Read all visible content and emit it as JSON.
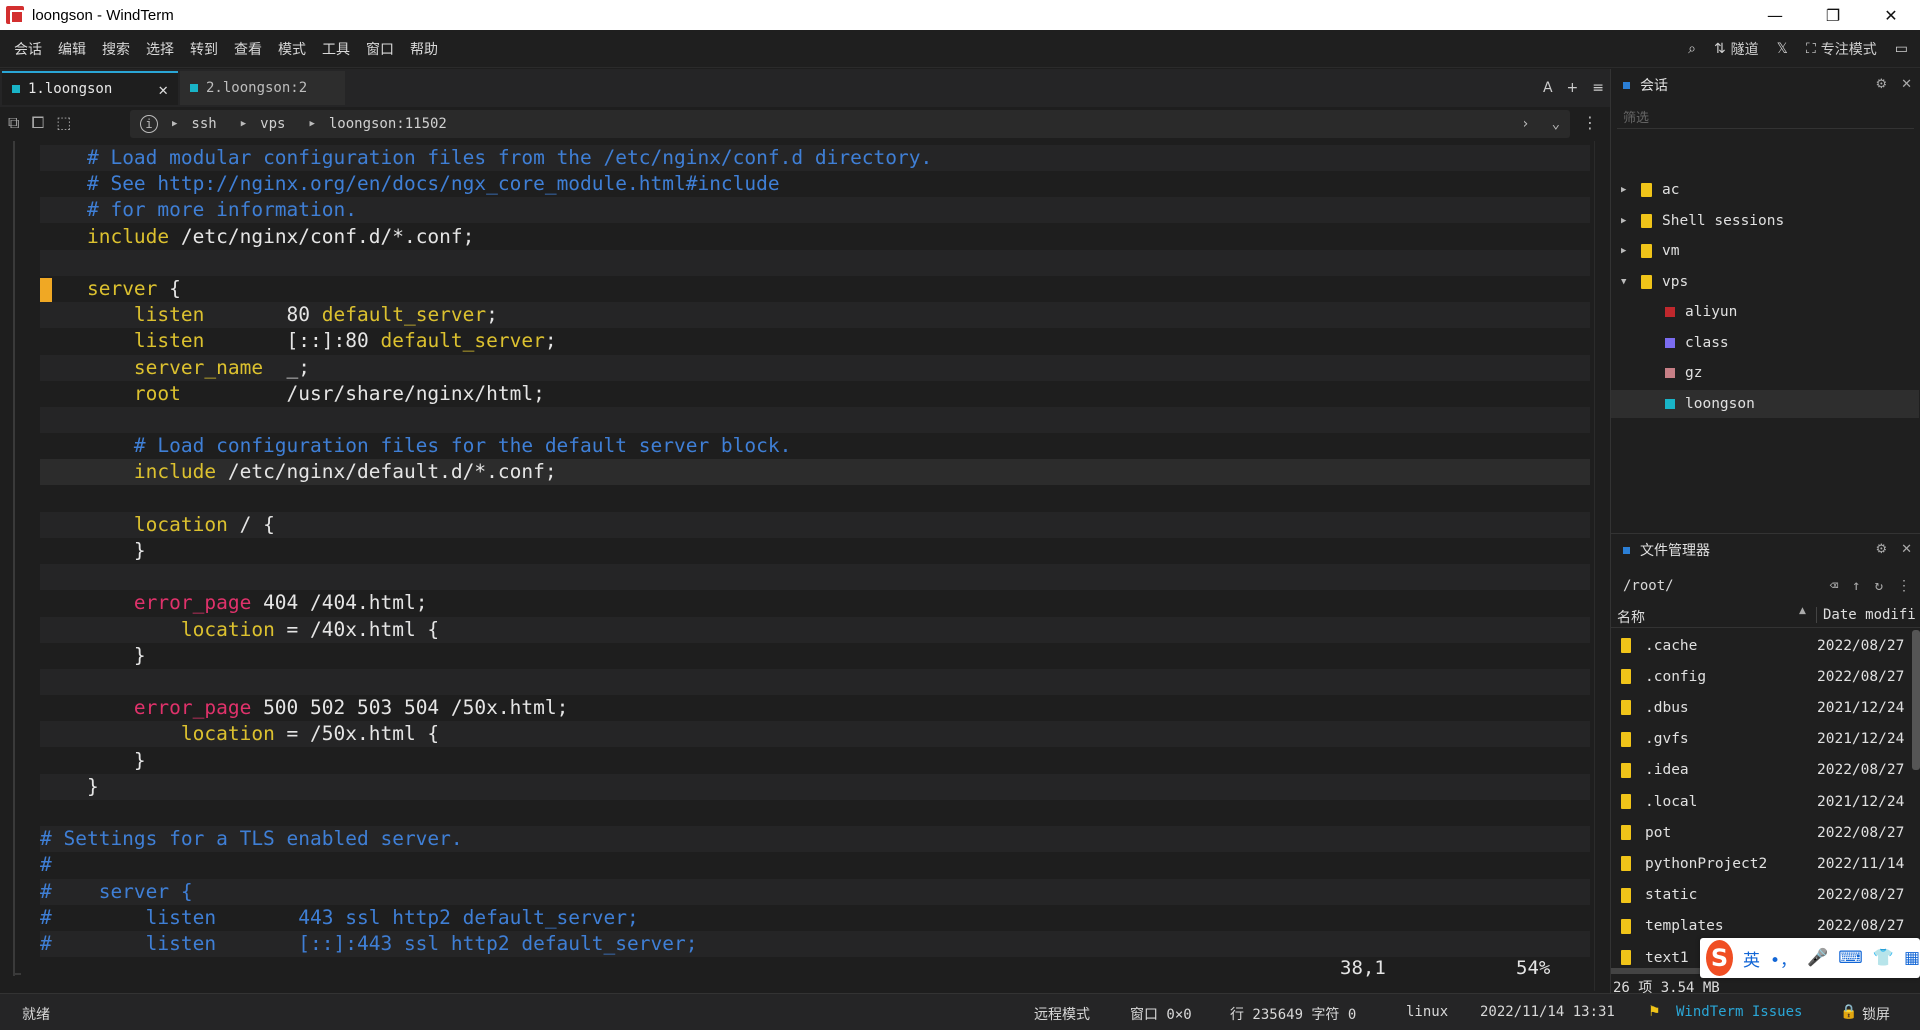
{
  "window": {
    "title": "loongson - WindTerm",
    "min": "—",
    "restore": "❐",
    "close": "✕"
  },
  "menu": [
    "会话",
    "编辑",
    "搜索",
    "选择",
    "转到",
    "查看",
    "模式",
    "工具",
    "窗口",
    "帮助"
  ],
  "toolbar_right": {
    "tunnel": "隧道",
    "focus_mode": "专注模式"
  },
  "tabs": [
    {
      "label": "1.loongson",
      "close": "✕"
    },
    {
      "label": "2.loongson:2"
    }
  ],
  "tab_tools": {
    "font": "A",
    "add": "+",
    "menu": "≡"
  },
  "address": {
    "seg1": "ssh",
    "seg2": "vps",
    "seg3": "loongson:11502"
  },
  "terminal": {
    "lines": [
      {
        "indent": "    ",
        "parts": [
          [
            "c-com",
            "# Load modular configuration files from the /etc/nginx/conf.d directory."
          ]
        ]
      },
      {
        "indent": "    ",
        "parts": [
          [
            "c-com",
            "# See http://nginx.org/en/docs/ngx_core_module.html#include"
          ]
        ]
      },
      {
        "indent": "    ",
        "parts": [
          [
            "c-com",
            "# for more information."
          ]
        ]
      },
      {
        "indent": "    ",
        "parts": [
          [
            "c-kw",
            "include"
          ],
          [
            "c-def",
            " /etc/nginx/conf.d/*.conf;"
          ]
        ]
      },
      {
        "indent": "",
        "parts": []
      },
      {
        "indent": "    ",
        "parts": [
          [
            "c-kw",
            "server"
          ],
          [
            "c-def",
            " {"
          ]
        ]
      },
      {
        "indent": "        ",
        "parts": [
          [
            "c-kw",
            "listen"
          ],
          [
            "c-def",
            "       80 "
          ],
          [
            "c-kw",
            "default_server"
          ],
          [
            "c-def",
            ";"
          ]
        ]
      },
      {
        "indent": "        ",
        "parts": [
          [
            "c-kw",
            "listen"
          ],
          [
            "c-def",
            "       [::]:80 "
          ],
          [
            "c-kw",
            "default_server"
          ],
          [
            "c-def",
            ";"
          ]
        ]
      },
      {
        "indent": "        ",
        "parts": [
          [
            "c-kw",
            "server_name"
          ],
          [
            "c-def",
            "  _;"
          ]
        ]
      },
      {
        "indent": "        ",
        "parts": [
          [
            "c-kw",
            "root"
          ],
          [
            "c-def",
            "         /usr/share/nginx/html;"
          ]
        ]
      },
      {
        "indent": "",
        "parts": []
      },
      {
        "indent": "        ",
        "parts": [
          [
            "c-com",
            "# Load configuration files for the default server block."
          ]
        ]
      },
      {
        "indent": "        ",
        "parts": [
          [
            "c-kw",
            "include"
          ],
          [
            "c-def",
            " /etc/nginx/default.d/*.conf;"
          ]
        ]
      },
      {
        "indent": "",
        "parts": []
      },
      {
        "indent": "        ",
        "parts": [
          [
            "c-kw",
            "location"
          ],
          [
            "c-def",
            " / {"
          ]
        ]
      },
      {
        "indent": "        ",
        "parts": [
          [
            "c-def",
            "}"
          ]
        ]
      },
      {
        "indent": "",
        "parts": []
      },
      {
        "indent": "        ",
        "parts": [
          [
            "c-err",
            "error_page"
          ],
          [
            "c-def",
            " 404 /404.html;"
          ]
        ]
      },
      {
        "indent": "            ",
        "parts": [
          [
            "c-kw",
            "location"
          ],
          [
            "c-def",
            " = /40x.html {"
          ]
        ]
      },
      {
        "indent": "        ",
        "parts": [
          [
            "c-def",
            "}"
          ]
        ]
      },
      {
        "indent": "",
        "parts": []
      },
      {
        "indent": "        ",
        "parts": [
          [
            "c-err",
            "error_page"
          ],
          [
            "c-def",
            " 500 502 503 504 /50x.html;"
          ]
        ]
      },
      {
        "indent": "            ",
        "parts": [
          [
            "c-kw",
            "location"
          ],
          [
            "c-def",
            " = /50x.html {"
          ]
        ]
      },
      {
        "indent": "        ",
        "parts": [
          [
            "c-def",
            "}"
          ]
        ]
      },
      {
        "indent": "    ",
        "parts": [
          [
            "c-def",
            "}"
          ]
        ]
      },
      {
        "indent": "",
        "parts": []
      },
      {
        "indent": "",
        "parts": [
          [
            "c-com",
            "# Settings for a TLS enabled server."
          ]
        ]
      },
      {
        "indent": "",
        "parts": [
          [
            "c-com",
            "#"
          ]
        ]
      },
      {
        "indent": "",
        "parts": [
          [
            "c-com",
            "#    server {"
          ]
        ]
      },
      {
        "indent": "",
        "parts": [
          [
            "c-com",
            "#        listen       443 ssl http2 default_server;"
          ]
        ]
      },
      {
        "indent": "",
        "parts": [
          [
            "c-com",
            "#        listen       [::]:443 ssl http2 default_server;"
          ]
        ]
      }
    ],
    "position": "38,1",
    "percent": "54%"
  },
  "sessions": {
    "title": "会话",
    "filter_placeholder": "筛选",
    "items": [
      {
        "label": "ac",
        "type": "folder",
        "expanded": false
      },
      {
        "label": "Shell sessions",
        "type": "folder",
        "expanded": false
      },
      {
        "label": "vm",
        "type": "folder",
        "expanded": false
      },
      {
        "label": "vps",
        "type": "folder",
        "expanded": true
      },
      {
        "label": "aliyun",
        "type": "session",
        "color": "#c0282d"
      },
      {
        "label": "class",
        "type": "session",
        "color": "#7b6cf0"
      },
      {
        "label": "gz",
        "type": "session",
        "color": "#c77f86"
      },
      {
        "label": "loongson",
        "type": "session",
        "color": "#19b4c7",
        "selected": true
      }
    ]
  },
  "file_manager": {
    "title": "文件管理器",
    "path": "/root/",
    "col_name": "名称",
    "col_date": "Date modifi",
    "files": [
      {
        "name": ".cache",
        "date": "2022/08/27"
      },
      {
        "name": ".config",
        "date": "2022/08/27"
      },
      {
        "name": ".dbus",
        "date": "2021/12/24"
      },
      {
        "name": ".gvfs",
        "date": "2021/12/24"
      },
      {
        "name": ".idea",
        "date": "2022/08/27"
      },
      {
        "name": ".local",
        "date": "2021/12/24"
      },
      {
        "name": "pot",
        "date": "2022/08/27"
      },
      {
        "name": "pythonProject2",
        "date": "2022/11/14"
      },
      {
        "name": "static",
        "date": "2022/08/27"
      },
      {
        "name": "templates",
        "date": "2022/08/27"
      },
      {
        "name": "text1",
        "date": ""
      }
    ],
    "summary": "26 项 3.54 MB"
  },
  "ime": {
    "lang": "英",
    "punct": "•，"
  },
  "status": {
    "ready": "就绪",
    "remote_mode": "远程模式",
    "window": "窗口 0×0",
    "row_char": "行 235649 字符 0",
    "os": "linux",
    "datetime": "2022/11/14 13:31",
    "issues": "WindTerm Issues",
    "lock": "锁屏"
  },
  "colors": {
    "accent": "#2aa6d6",
    "comment": "#3f7fd6",
    "keyword": "#dcc12f",
    "error_kw": "#e0326b",
    "cursor": "#f0a824"
  }
}
